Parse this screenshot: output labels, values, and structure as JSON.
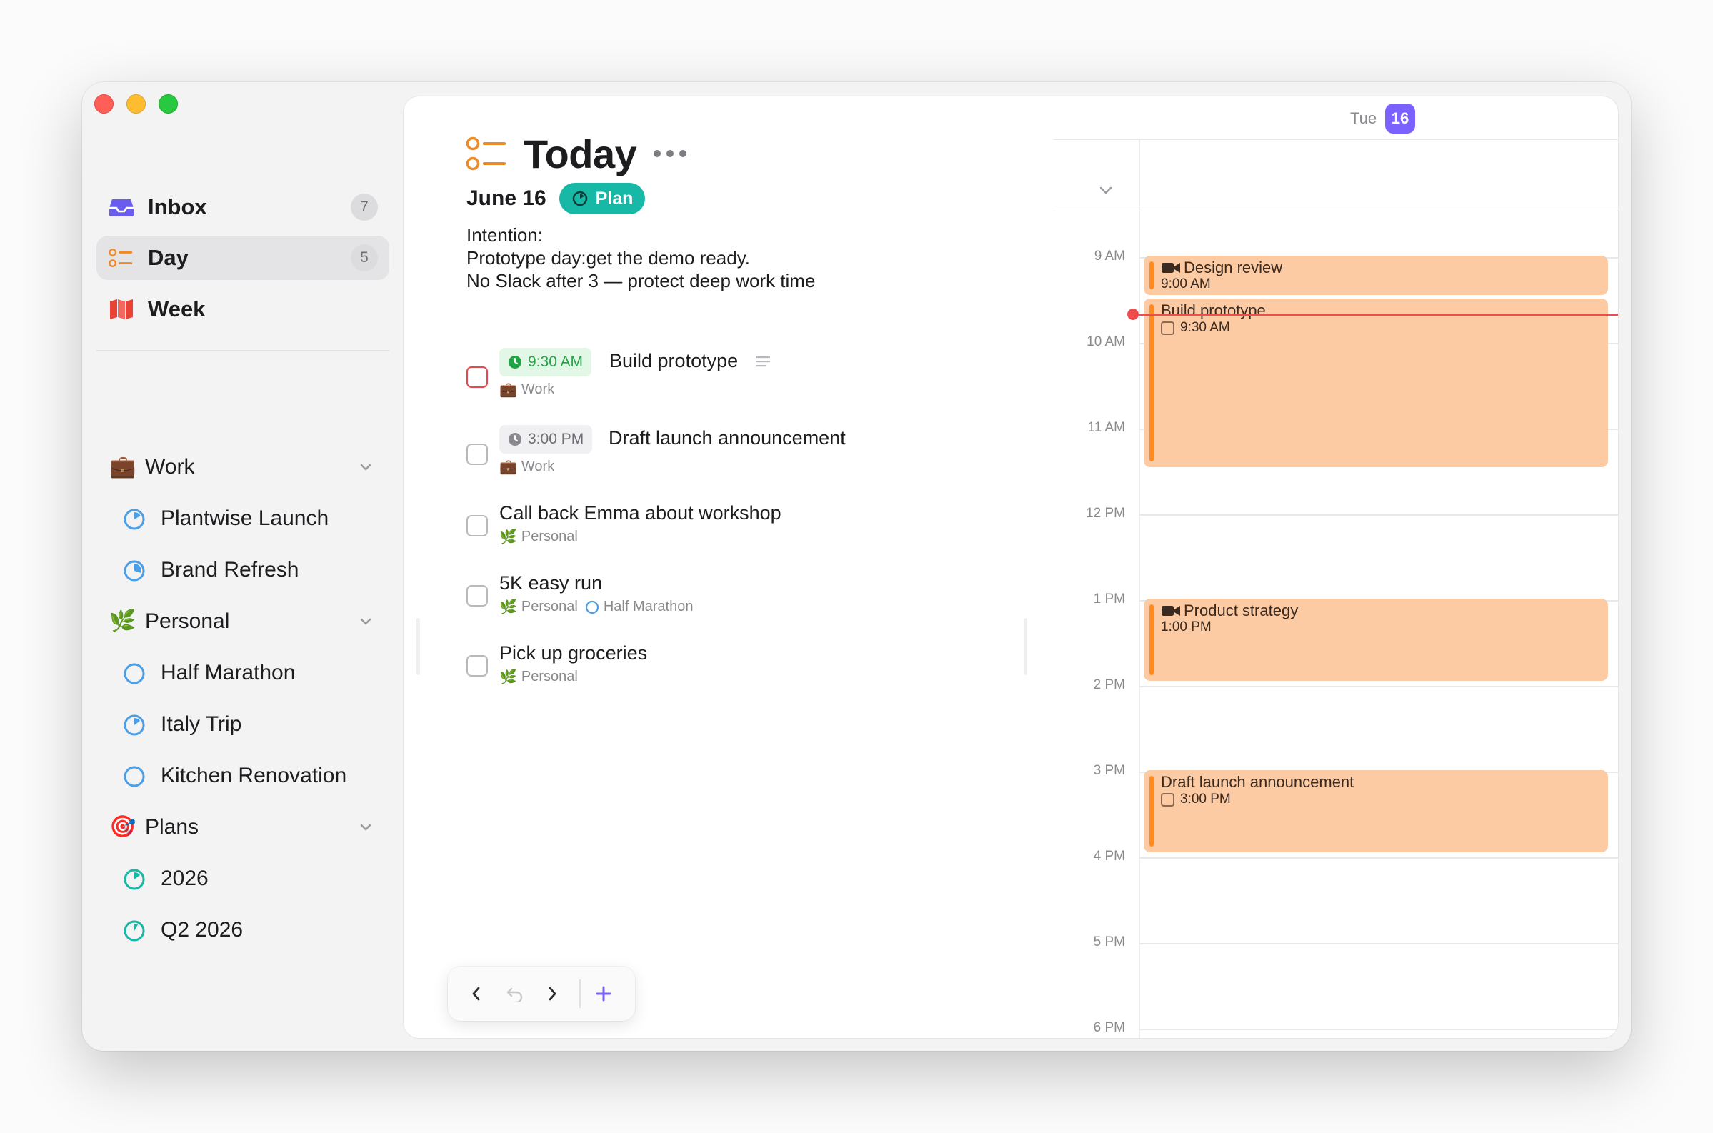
{
  "sidebar": {
    "inbox": {
      "label": "Inbox",
      "count": "7"
    },
    "day": {
      "label": "Day",
      "count": "5"
    },
    "week": {
      "label": "Week"
    },
    "groups": [
      {
        "label": "Work",
        "icon": "briefcase-icon",
        "children": [
          "Plantwise Launch",
          "Brand Refresh"
        ]
      },
      {
        "label": "Personal",
        "icon": "herb-icon",
        "children": [
          "Half Marathon",
          "Italy Trip",
          "Kitchen Renovation"
        ]
      },
      {
        "label": "Plans",
        "icon": "target-icon",
        "children": [
          "2026",
          "Q2 2026"
        ]
      }
    ]
  },
  "main": {
    "title": "Today",
    "date": "June 16",
    "plan_button": "Plan",
    "intention": {
      "heading": "Intention:",
      "line1": "Prototype day:get the demo ready.",
      "line2": "No Slack after 3 — protect deep work time"
    },
    "tasks": [
      {
        "time": "9:30 AM",
        "title": "Build prototype",
        "area": "Work"
      },
      {
        "time": "3:00 PM",
        "title": "Draft launch announcement",
        "area": "Work"
      },
      {
        "title": "Call back Emma about workshop",
        "area": "Personal"
      },
      {
        "title": "5K easy run",
        "area": "Personal",
        "project": "Half Marathon"
      },
      {
        "title": "Pick up groceries",
        "area": "Personal"
      }
    ]
  },
  "calendar": {
    "day_name": "Tue",
    "day_number": "16",
    "hours": [
      "9 AM",
      "10 AM",
      "11 AM",
      "12 PM",
      "1 PM",
      "2 PM",
      "3 PM",
      "4 PM",
      "5 PM",
      "6 PM"
    ],
    "events": [
      {
        "title": "Design review",
        "time": "9:00 AM"
      },
      {
        "title": "Build prototype",
        "time": "9:30 AM"
      },
      {
        "title": "Product strategy",
        "time": "1:00 PM"
      },
      {
        "title": "Draft launch announcement",
        "time": "3:00 PM"
      }
    ]
  },
  "colors": {
    "accent_purple": "#7b61ff",
    "plan_teal": "#17b8a6",
    "event_fill": "#fccba3",
    "event_bar": "#ff8a1f",
    "now_line": "#ef4d4d",
    "time_green": "#22a447"
  }
}
